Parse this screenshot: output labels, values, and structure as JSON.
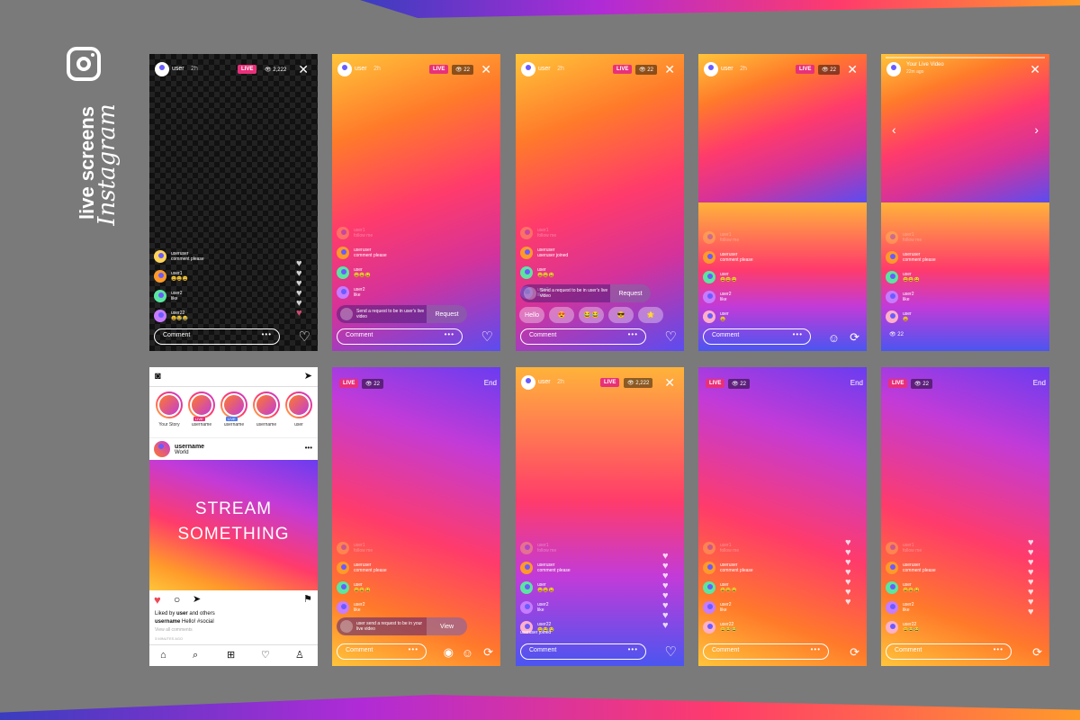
{
  "brand": {
    "line1": "live screens",
    "line2": "Instagram"
  },
  "common": {
    "user": "user",
    "time": "2h",
    "live": "LIVE",
    "viewers_big": "2,222",
    "viewers": "22",
    "comment": "Comment",
    "dots": "•••",
    "end": "End",
    "close": "✕",
    "heart": "♡"
  },
  "comments_a": [
    {
      "name": "useruser",
      "text": "comment please"
    },
    {
      "name": "user1",
      "text": "😀😀😀"
    },
    {
      "name": "user2",
      "text": "like"
    },
    {
      "name": "user22",
      "text": "😀😂😂"
    }
  ],
  "comments_b": [
    {
      "name": "user1",
      "text": "follow me"
    },
    {
      "name": "useruser",
      "text": "comment please"
    },
    {
      "name": "user",
      "text": "😀😀😀"
    },
    {
      "name": "user2",
      "text": "like"
    }
  ],
  "comments_c": [
    {
      "name": "user1",
      "text": "follow me"
    },
    {
      "name": "useruser",
      "text": "useruser joined"
    },
    {
      "name": "user",
      "text": "😀😀😀"
    },
    {
      "name": "user2",
      "text": "like"
    }
  ],
  "comments_d": [
    {
      "name": "user1",
      "text": "follow me"
    },
    {
      "name": "useruser",
      "text": "comment please"
    },
    {
      "name": "user",
      "text": "😀😀😀"
    },
    {
      "name": "user2",
      "text": "like"
    },
    {
      "name": "user",
      "text": "😀"
    }
  ],
  "comments_e": [
    {
      "name": "user1",
      "text": "follow me"
    },
    {
      "name": "useruser",
      "text": "comment please"
    },
    {
      "name": "user",
      "text": "😀😀😀"
    },
    {
      "name": "user2",
      "text": "like"
    },
    {
      "name": "user22",
      "text": "😀😂😂"
    }
  ],
  "request": {
    "text1": "Send a request to be in user's live video",
    "btn": "Request",
    "text2": "user send a request to be in your live video",
    "view": "View"
  },
  "reactions": [
    "Hello",
    "😍",
    "😂😂",
    "😎",
    "🌟"
  ],
  "your_live": {
    "title": "Your Live Video",
    "ago": "22m ago"
  },
  "joined": "useruser joined",
  "feed": {
    "stories": [
      {
        "label": "Your Story",
        "badge": ""
      },
      {
        "label": "username",
        "badge": "LIVE"
      },
      {
        "label": "username",
        "badge": "LIVE"
      },
      {
        "label": "username",
        "badge": ""
      },
      {
        "label": "user",
        "badge": ""
      }
    ],
    "post_user": "username",
    "post_loc": "World",
    "post_l1": "STREAM",
    "post_l2": "SOMETHING",
    "liked_prefix": "Liked by ",
    "liked_user": "user",
    "liked_suffix": " and others",
    "cap_user": "username",
    "cap_text": " Hello! #social",
    "view_all": "View all comments",
    "time": "3 MINUTES AGO"
  }
}
